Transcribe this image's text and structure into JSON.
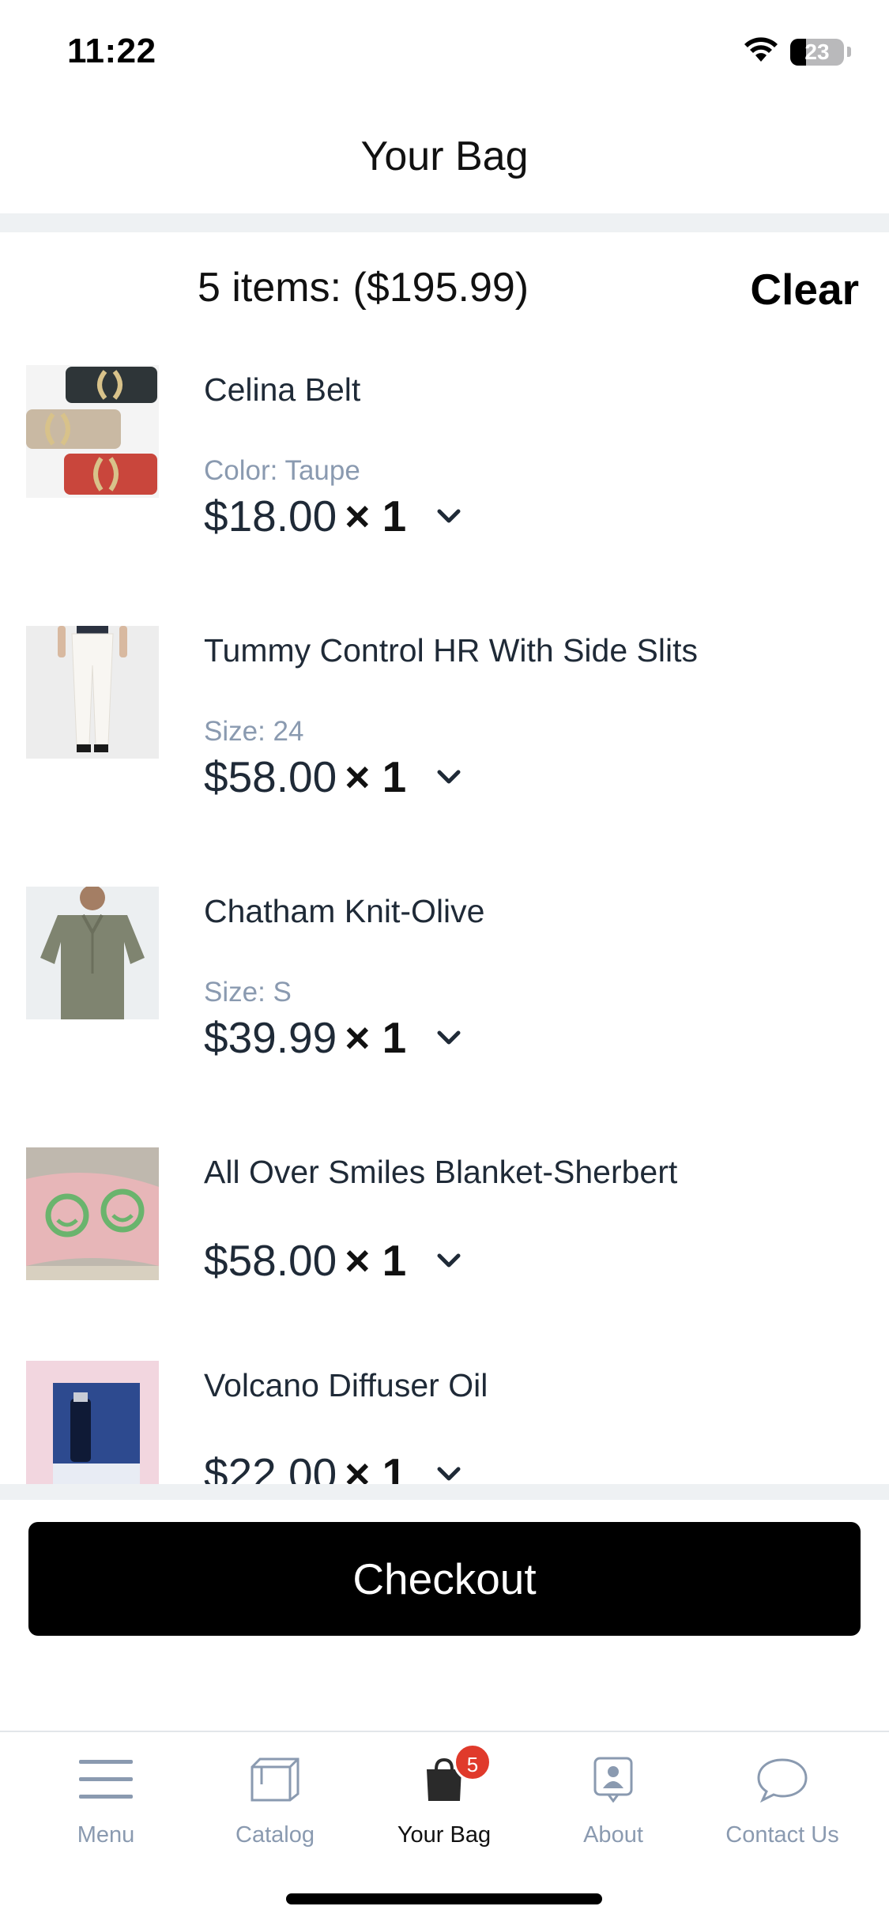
{
  "status_bar": {
    "time": "11:22",
    "battery_level": "23"
  },
  "header": {
    "title": "Your Bag"
  },
  "summary": {
    "text": "5 items: ($195.99)",
    "clear_label": "Clear"
  },
  "items": [
    {
      "name": "Celina Belt",
      "variant": "Color: Taupe",
      "price": "$18.00",
      "qty": "× 1"
    },
    {
      "name": "Tummy Control HR With Side Slits",
      "variant": "Size: 24",
      "price": "$58.00",
      "qty": "× 1"
    },
    {
      "name": "Chatham Knit-Olive",
      "variant": "Size: S",
      "price": "$39.99",
      "qty": "× 1"
    },
    {
      "name": "All Over Smiles Blanket-Sherbert",
      "variant": "",
      "price": "$58.00",
      "qty": "× 1"
    },
    {
      "name": "Volcano Diffuser Oil",
      "variant": "",
      "price": "$22.00",
      "qty": "× 1"
    }
  ],
  "checkout": {
    "label": "Checkout"
  },
  "tabbar": {
    "tabs": [
      {
        "label": "Menu",
        "icon": "menu-icon"
      },
      {
        "label": "Catalog",
        "icon": "catalog-icon"
      },
      {
        "label": "Your Bag",
        "icon": "bag-icon",
        "badge": "5",
        "active": true
      },
      {
        "label": "About",
        "icon": "about-icon"
      },
      {
        "label": "Contact Us",
        "icon": "chat-icon"
      }
    ]
  },
  "colors": {
    "accent": "#000000",
    "badge": "#e03a2b",
    "muted": "#8a9ab0",
    "text": "#1f2a37"
  }
}
